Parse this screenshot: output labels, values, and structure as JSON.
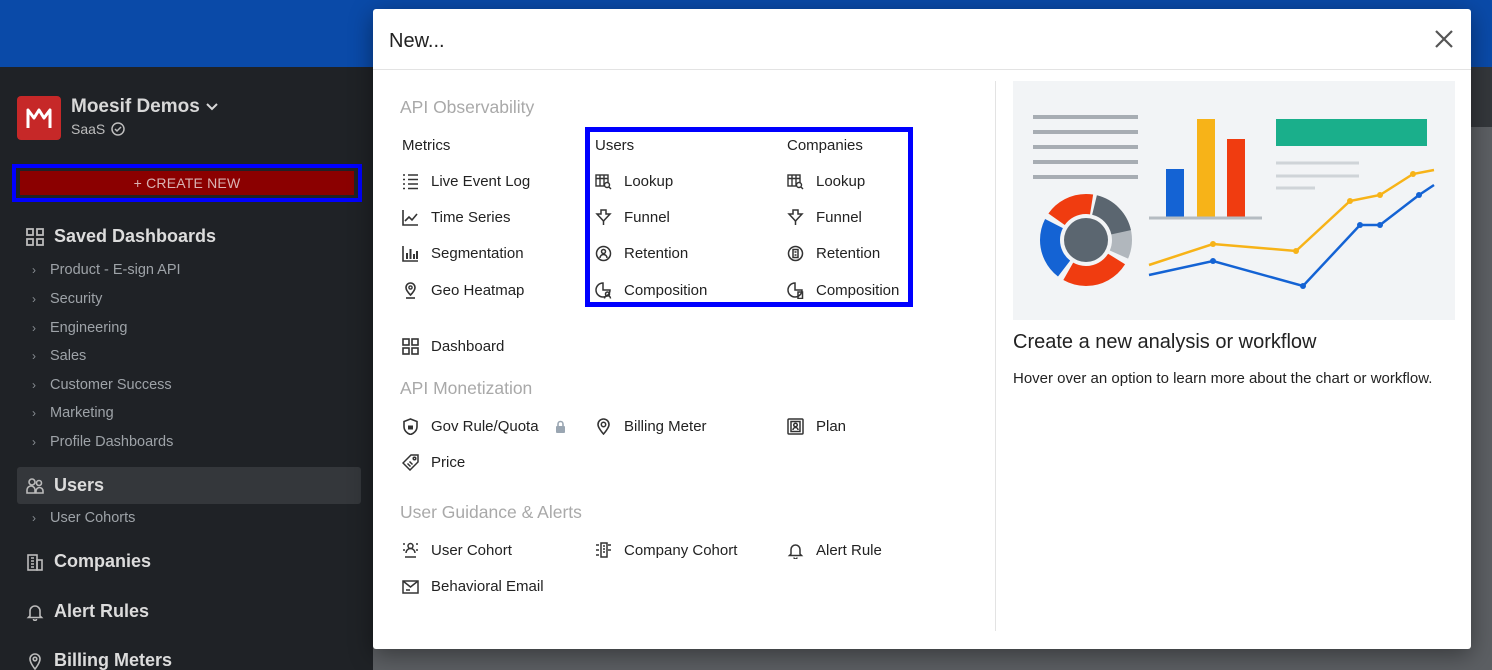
{
  "org": {
    "name": "Moesif Demos",
    "plan": "SaaS"
  },
  "sidebar": {
    "create_new": "+ CREATE NEW",
    "saved_dashboards": {
      "label": "Saved Dashboards",
      "items": [
        "Product - E-sign API",
        "Security",
        "Engineering",
        "Sales",
        "Customer Success",
        "Marketing",
        "Profile Dashboards"
      ]
    },
    "users": {
      "label": "Users",
      "items": [
        "User Cohorts"
      ]
    },
    "companies": {
      "label": "Companies"
    },
    "alert_rules": {
      "label": "Alert Rules"
    },
    "billing_meters": {
      "label": "Billing Meters"
    }
  },
  "modal": {
    "title": "New...",
    "api_observability": {
      "title": "API Observability",
      "metrics": {
        "header": "Metrics",
        "items": [
          "Live Event Log",
          "Time Series",
          "Segmentation",
          "Geo Heatmap"
        ]
      },
      "users": {
        "header": "Users",
        "items": [
          "Lookup",
          "Funnel",
          "Retention",
          "Composition"
        ]
      },
      "companies": {
        "header": "Companies",
        "items": [
          "Lookup",
          "Funnel",
          "Retention",
          "Composition"
        ]
      },
      "dashboard": "Dashboard"
    },
    "api_monetization": {
      "title": "API Monetization",
      "items": [
        "Gov Rule/Quota",
        "Billing Meter",
        "Plan",
        "Price"
      ]
    },
    "user_guidance": {
      "title": "User Guidance & Alerts",
      "items": [
        "User Cohort",
        "Company Cohort",
        "Alert Rule",
        "Behavioral Email"
      ]
    },
    "preview": {
      "title": "Create a new analysis or workflow",
      "description": "Hover over an option to learn more about the chart or workflow."
    }
  },
  "colors": {
    "topbar": "#0a4aa8",
    "highlight": "#0000ff",
    "create_btn": "#8b0000",
    "accent_green": "#1aaf8b"
  }
}
